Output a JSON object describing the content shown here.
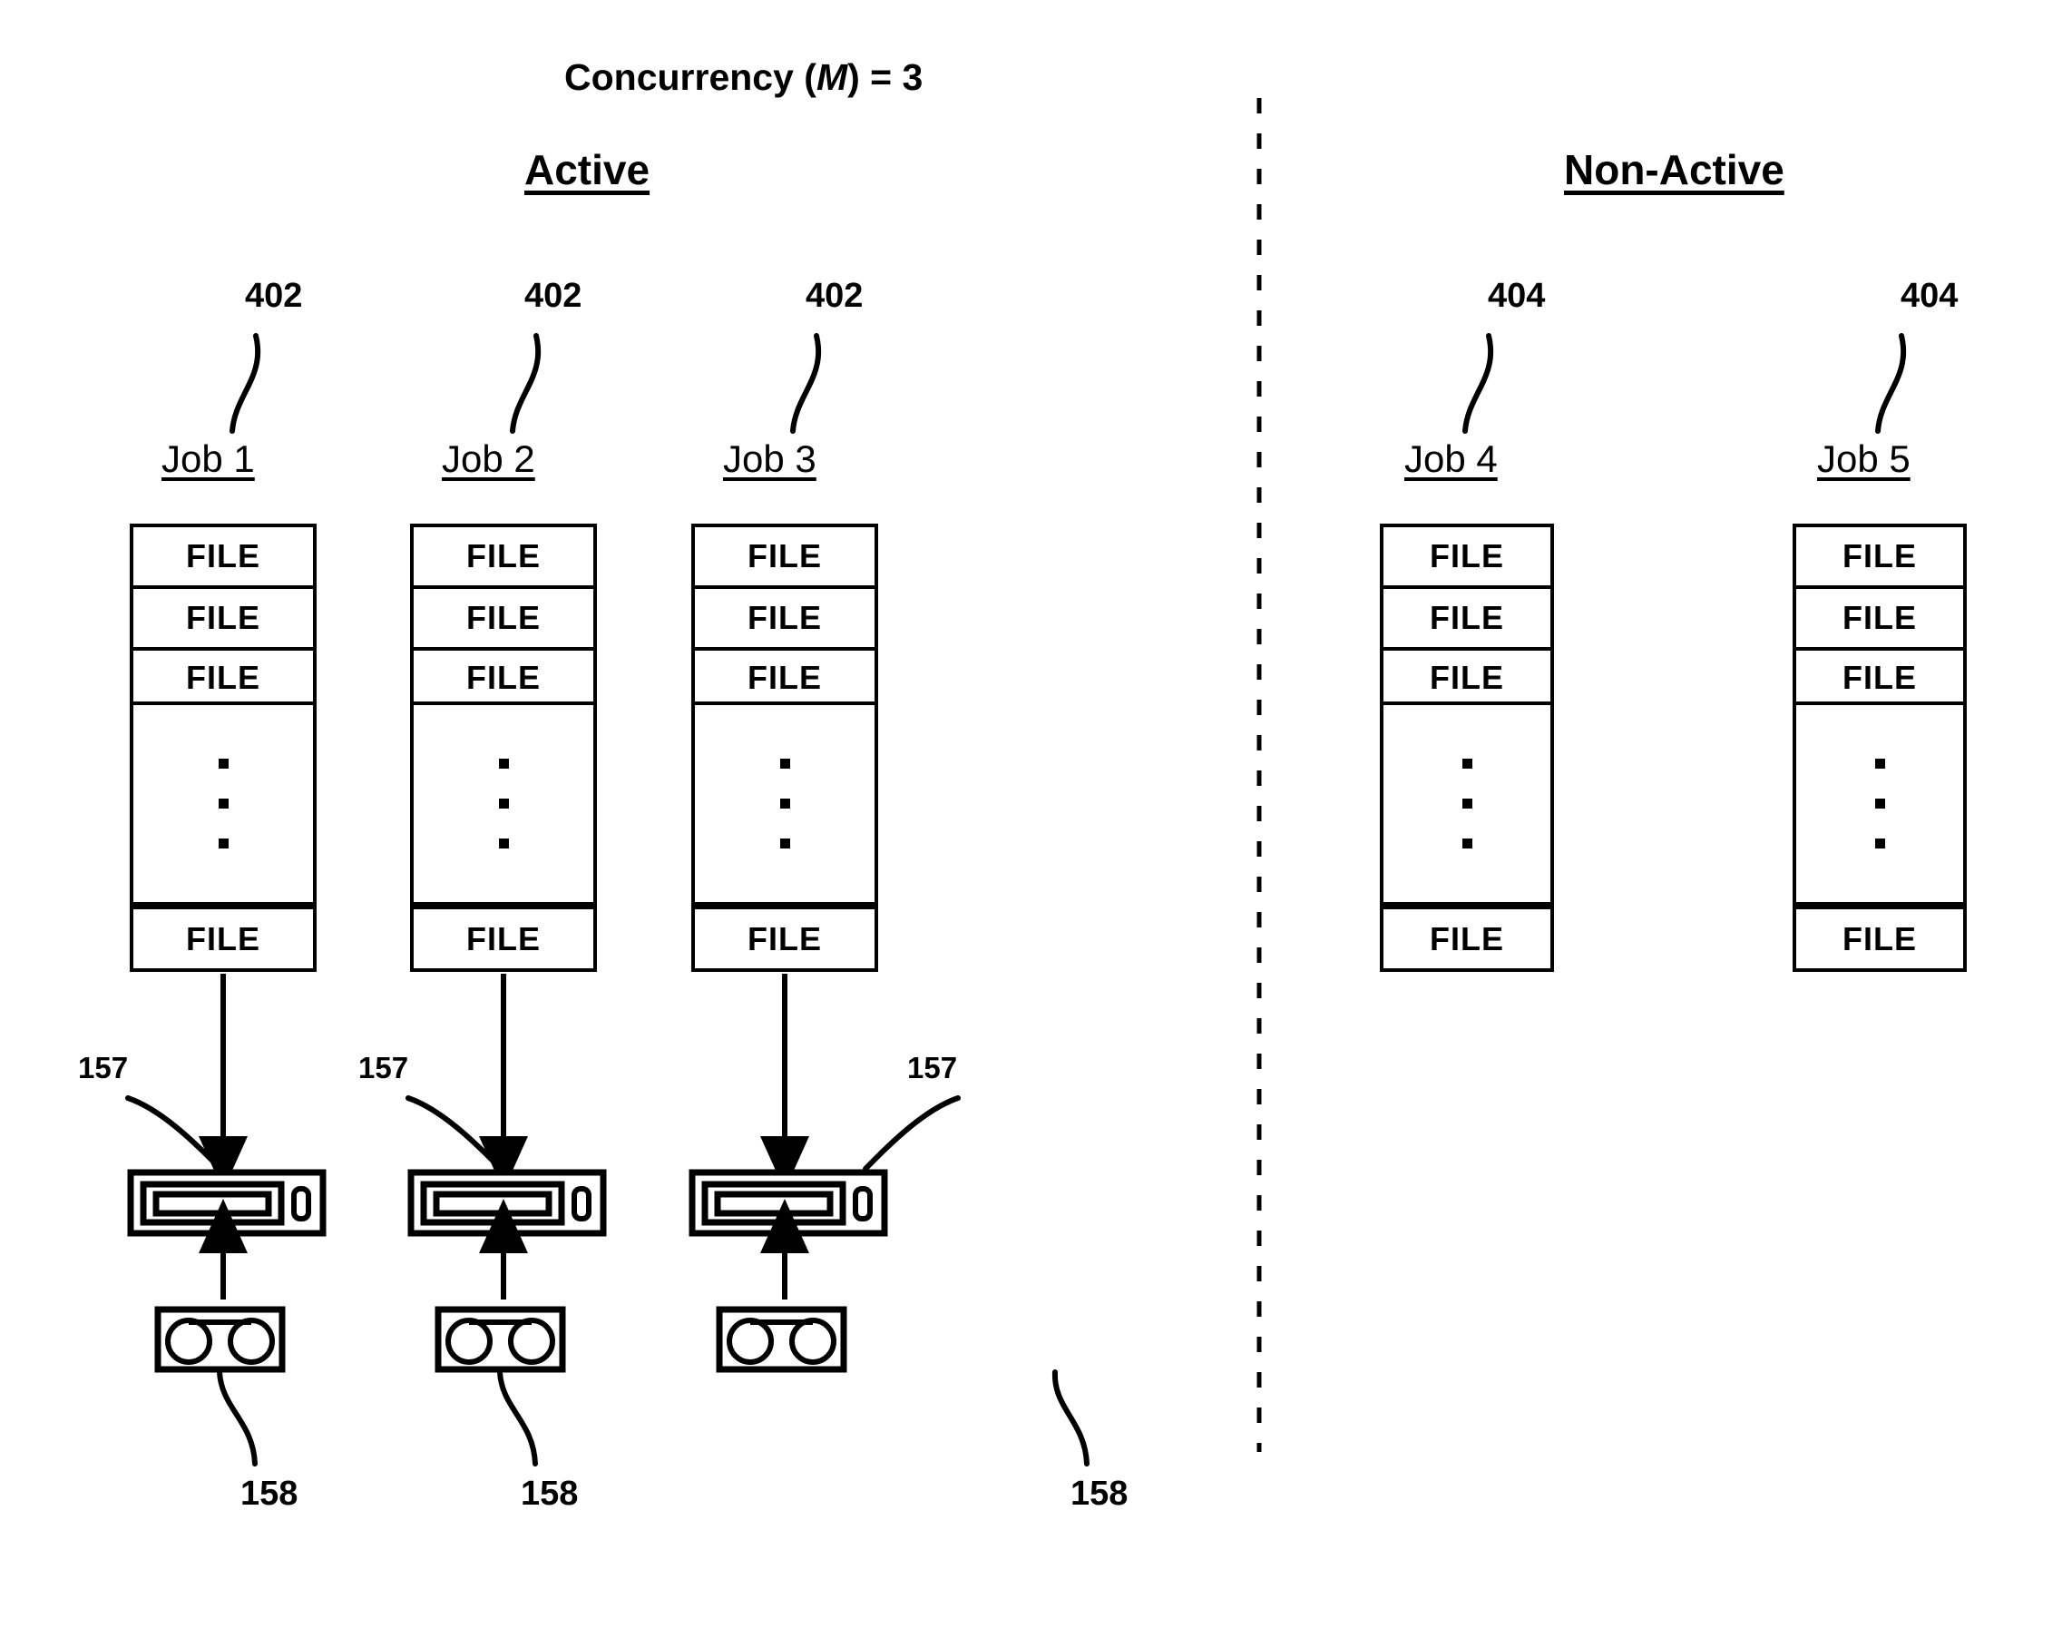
{
  "figure": {
    "title_prefix": "Concurrency (",
    "title_variable": "M",
    "title_suffix": ") = 3",
    "title_full": "Concurrency (M) = 3"
  },
  "sections": {
    "active_label": "Active",
    "non_active_label": "Non-Active",
    "divider": "dashed-vertical-divider"
  },
  "columns": [
    {
      "id": "job-1",
      "ref": "402",
      "job_label": "Job 1",
      "state": "active",
      "files_top": [
        "FILE",
        "FILE",
        "FILE"
      ],
      "ellipsis_dots": 3,
      "files_bottom": [
        "FILE"
      ],
      "drive_ref": "157",
      "cartridge_ref": "158"
    },
    {
      "id": "job-2",
      "ref": "402",
      "job_label": "Job 2",
      "state": "active",
      "files_top": [
        "FILE",
        "FILE",
        "FILE"
      ],
      "ellipsis_dots": 3,
      "files_bottom": [
        "FILE"
      ],
      "drive_ref": "157",
      "cartridge_ref": "158"
    },
    {
      "id": "job-3",
      "ref": "402",
      "job_label": "Job 3",
      "state": "active",
      "files_top": [
        "FILE",
        "FILE",
        "FILE"
      ],
      "ellipsis_dots": 3,
      "files_bottom": [
        "FILE"
      ],
      "drive_ref": "157",
      "cartridge_ref": "158"
    },
    {
      "id": "job-4",
      "ref": "404",
      "job_label": "Job 4",
      "state": "non-active",
      "files_top": [
        "FILE",
        "FILE",
        "FILE"
      ],
      "ellipsis_dots": 3,
      "files_bottom": [
        "FILE"
      ],
      "drive_ref": null,
      "cartridge_ref": null
    },
    {
      "id": "job-5",
      "ref": "404",
      "job_label": "Job 5",
      "state": "non-active",
      "files_top": [
        "FILE",
        "FILE",
        "FILE"
      ],
      "ellipsis_dots": 3,
      "files_bottom": [
        "FILE"
      ],
      "drive_ref": null,
      "cartridge_ref": null
    }
  ],
  "icons": {
    "tape_drive": "tape-drive-icon",
    "tape_cartridge": "tape-cartridge-icon",
    "arrow_down": "arrow-down-icon",
    "arrow_up": "arrow-up-icon",
    "leader_line": "leader-line"
  },
  "colors": {
    "ink": "#000000",
    "paper": "#ffffff"
  }
}
